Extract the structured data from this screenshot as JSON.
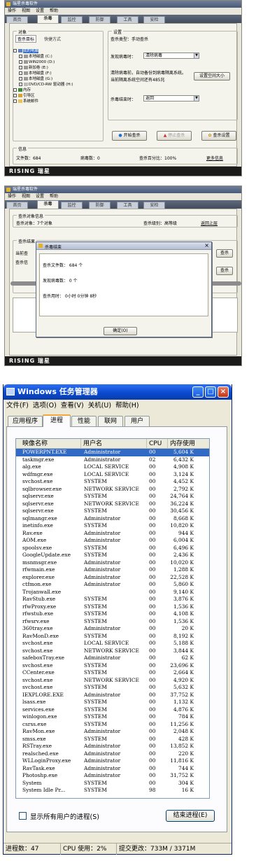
{
  "rising1": {
    "title": "瑞星杀毒软件",
    "menu": [
      "操作",
      "视图",
      "设置",
      "帮助"
    ],
    "tabs": [
      "首页",
      "杀毒",
      "监控",
      "防御",
      "工具",
      "安检"
    ],
    "object_group": "对象",
    "subtabs": [
      "查杀目标",
      "快捷方式"
    ],
    "tree": [
      "我的电脑",
      "本地磁盘 (C:)",
      "WIN2000 (D:)",
      "新加卷 (E:)",
      "本地磁盘 (F:)",
      "本地磁盘 (G:)",
      "DVD/CD-RW 驱动器 (H:)",
      "内存",
      "引导区",
      "系统邮件"
    ],
    "settings_group": "设置",
    "scan_type": "查杀类型：手动查杀",
    "virus_found_label": "发现病毒时：",
    "virus_found_value": "清除病毒",
    "quarantine_info1": "清除病毒前，自动备份到病毒隔离系统。",
    "quarantine_info2": "当前隔离系统空间还有485兆",
    "quarantine_btn": "设置空间大小",
    "finish_label": "杀毒结束时：",
    "finish_value": "返回",
    "start_btn": "开始查杀",
    "stop_btn": "停止查杀",
    "settings_btn": "查杀设置",
    "info_group": "信息",
    "files_count": "文件数：684",
    "virus_count": "病毒数：0",
    "percent": "查杀百分比：100%",
    "more_info": "更多信息",
    "brand": "RISING 瑞星"
  },
  "rising2": {
    "title": "瑞星杀毒软件",
    "menu": [
      "操作",
      "视图",
      "设置",
      "帮助"
    ],
    "tabs": [
      "首页",
      "杀毒",
      "监控",
      "防御",
      "工具",
      "安检"
    ],
    "scan_info_group": "查杀对象信息",
    "scan_objects": "查杀对象：7个对象",
    "scan_level": "查杀级别：高等级",
    "return_link": "返回上层",
    "result_group": "查杀结果",
    "partial1": "当前查",
    "partial2": "查杀信",
    "partial_btn": "查杀",
    "dialog_title": "杀毒结束",
    "dlg_files": "查杀文件数：   684 个",
    "dlg_virus": "发现病毒数：   0 个",
    "dlg_time": "查杀用时：   0小时 0分钟 8秒",
    "ok_btn": "确定(O)",
    "brand": "RISING 瑞星"
  },
  "taskmgr": {
    "title": "Windows 任务管理器",
    "menu": [
      "文件(F)",
      "选项(O)",
      "查看(V)",
      "关机(U)",
      "帮助(H)"
    ],
    "tabs": [
      "应用程序",
      "进程",
      "性能",
      "联网",
      "用户"
    ],
    "headers": [
      "映像名称",
      "用户名",
      "CPU",
      "内存使用"
    ],
    "processes": [
      [
        "POWERPNT.EXE",
        "Administrator",
        "00",
        "5,604 K"
      ],
      [
        "taskmgr.exe",
        "Administrator",
        "02",
        "6,432 K"
      ],
      [
        "alg.exe",
        "LOCAL SERVICE",
        "00",
        "4,908 K"
      ],
      [
        "wdfmgr.exe",
        "LOCAL SERVICE",
        "00",
        "3,124 K"
      ],
      [
        "svchost.exe",
        "SYSTEM",
        "00",
        "4,452 K"
      ],
      [
        "sqlbrowser.exe",
        "NETWORK SERVICE",
        "00",
        "2,792 K"
      ],
      [
        "sqlservr.exe",
        "SYSTEM",
        "00",
        "24,764 K"
      ],
      [
        "sqlservr.exe",
        "NETWORK SERVICE",
        "00",
        "36,224 K"
      ],
      [
        "sqlservr.exe",
        "SYSTEM",
        "00",
        "30,456 K"
      ],
      [
        "sqlmangr.exe",
        "Administrator",
        "00",
        "8,668 K"
      ],
      [
        "inetinfo.exe",
        "SYSTEM",
        "00",
        "10,820 K"
      ],
      [
        "Rav.exe",
        "Administrator",
        "00",
        "944 K"
      ],
      [
        "AOM.exe",
        "Administrator",
        "00",
        "6,004 K"
      ],
      [
        "spoolsv.exe",
        "SYSTEM",
        "00",
        "6,496 K"
      ],
      [
        "GoogleUpdate.exe",
        "SYSTEM",
        "00",
        "2,436 K"
      ],
      [
        "msnmsgr.exe",
        "Administrator",
        "00",
        "10,020 K"
      ],
      [
        "rfwmain.exe",
        "Administrator",
        "00",
        "1,288 K"
      ],
      [
        "explorer.exe",
        "Administrator",
        "00",
        "22,528 K"
      ],
      [
        "ctfmon.exe",
        "Administrator",
        "00",
        "5,860 K"
      ],
      [
        "Trojanwall.exe",
        "",
        "00",
        "9,140 K"
      ],
      [
        "RavStub.exe",
        "SYSTEM",
        "00",
        "3,876 K"
      ],
      [
        "rfwProxy.exe",
        "SYSTEM",
        "00",
        "1,536 K"
      ],
      [
        "rfwstub.exe",
        "SYSTEM",
        "00",
        "4,108 K"
      ],
      [
        "rfwsrv.exe",
        "SYSTEM",
        "00",
        "1,536 K"
      ],
      [
        "360tray.exe",
        "Administrator",
        "00",
        "20 K"
      ],
      [
        "RavMonD.exe",
        "SYSTEM",
        "00",
        "8,192 K"
      ],
      [
        "svchost.exe",
        "LOCAL SERVICE",
        "00",
        "5,188 K"
      ],
      [
        "svchost.exe",
        "NETWORK SERVICE",
        "00",
        "3,844 K"
      ],
      [
        "safeboxTray.exe",
        "Administrator",
        "00",
        "62 K"
      ],
      [
        "svchost.exe",
        "SYSTEM",
        "00",
        "23,696 K"
      ],
      [
        "CCenter.exe",
        "SYSTEM",
        "00",
        "2,664 K"
      ],
      [
        "svchost.exe",
        "NETWORK SERVICE",
        "00",
        "4,920 K"
      ],
      [
        "svchost.exe",
        "SYSTEM",
        "00",
        "5,632 K"
      ],
      [
        "IEXPLORE.EXE",
        "Administrator",
        "00",
        "37,752 K"
      ],
      [
        "lsass.exe",
        "SYSTEM",
        "00",
        "1,132 K"
      ],
      [
        "services.exe",
        "SYSTEM",
        "00",
        "4,876 K"
      ],
      [
        "winlogon.exe",
        "SYSTEM",
        "00",
        "784 K"
      ],
      [
        "csrss.exe",
        "SYSTEM",
        "00",
        "11,256 K"
      ],
      [
        "RavMon.exe",
        "Administrator",
        "00",
        "2,048 K"
      ],
      [
        "smss.exe",
        "SYSTEM",
        "00",
        "428 K"
      ],
      [
        "RSTray.exe",
        "Administrator",
        "00",
        "13,852 K"
      ],
      [
        "realsched.exe",
        "Administrator",
        "00",
        "220 K"
      ],
      [
        "WLLoginProxy.exe",
        "Administrator",
        "00",
        "11,816 K"
      ],
      [
        "RavTask.exe",
        "Administrator",
        "00",
        "744 K"
      ],
      [
        "Photoshp.exe",
        "Administrator",
        "00",
        "31,752 K"
      ],
      [
        "System",
        "SYSTEM",
        "00",
        "304 K"
      ],
      [
        "System Idle Pr...",
        "SYSTEM",
        "98",
        "16 K"
      ]
    ],
    "show_all": "显示所有用户的进程(S)",
    "end_process": "结束进程(E)",
    "status": [
      "进程数：47",
      "CPU 使用：2%",
      "提交更改：733M / 3371M"
    ]
  }
}
